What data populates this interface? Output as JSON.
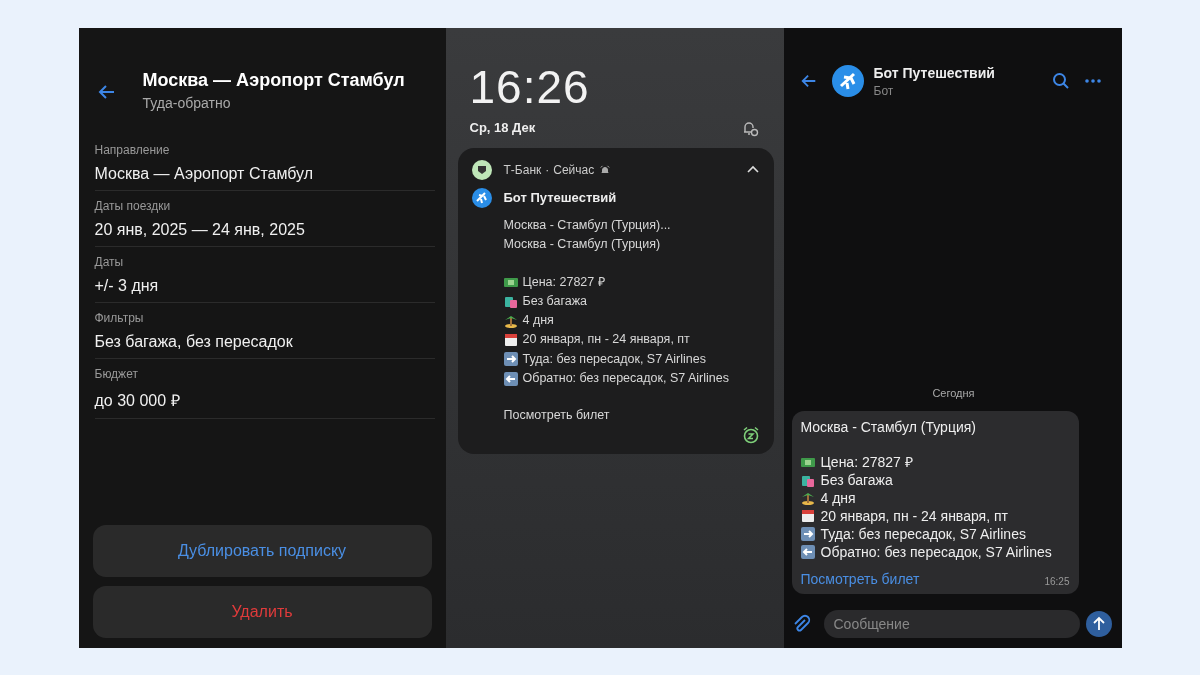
{
  "settings": {
    "title": "Москва — Аэропорт Стамбул",
    "subtitle": "Туда-обратно",
    "fields": [
      {
        "label": "Направление",
        "value": "Москва — Аэропорт Стамбул"
      },
      {
        "label": "Даты поездки",
        "value": "20 янв, 2025 — 24 янв, 2025"
      },
      {
        "label": "Даты",
        "value": "+/- 3 дня"
      },
      {
        "label": "Фильтры",
        "value": "Без багажа, без пересадок"
      },
      {
        "label": "Бюджет",
        "value": "до 30 000 ₽"
      }
    ],
    "buttons": [
      {
        "label": "Дублировать подписку",
        "kind": "primary"
      },
      {
        "label": "Удалить",
        "kind": "danger"
      }
    ]
  },
  "lockscreen": {
    "time": "16:26",
    "date": "Ср, 18 Дек",
    "notification": {
      "app": "Т-Банк",
      "separator": "·",
      "when": "Сейчас",
      "expanded": true,
      "sender": "Бот Путешествий",
      "preview": "Москва - Стамбул (Турция)...",
      "headline": "Москва - Стамбул (Турция)",
      "details": [
        {
          "kind": "money",
          "text": "Цена: 27827 ₽"
        },
        {
          "kind": "bag",
          "text": "Без багажа"
        },
        {
          "kind": "island",
          "text": "4 дня"
        },
        {
          "kind": "calendar",
          "text": "20 января, пн - 24 января, пт"
        },
        {
          "kind": "arrow-right",
          "text": "Туда: без пересадок, S7 Airlines"
        },
        {
          "kind": "arrow-left",
          "text": "Обратно: без пересадок, S7 Airlines"
        }
      ],
      "link": "Посмотреть билет"
    }
  },
  "chat": {
    "name": "Бот Путешествий",
    "status": "Бот",
    "day": "Сегодня",
    "message": {
      "headline": "Москва - Стамбул (Турция)",
      "details": [
        {
          "kind": "money",
          "text": "Цена: 27827 ₽"
        },
        {
          "kind": "bag",
          "text": "Без багажа"
        },
        {
          "kind": "island",
          "text": "4 дня"
        },
        {
          "kind": "calendar",
          "text": "20 января, пн - 24 января, пт"
        },
        {
          "kind": "arrow-right",
          "text": "Туда: без пересадок, S7 Airlines"
        },
        {
          "kind": "arrow-left",
          "text": "Обратно: без пересадок, S7 Airlines"
        }
      ],
      "link": "Посмотреть билет",
      "time": "16:25"
    },
    "input": {
      "placeholder": "Сообщение"
    }
  }
}
